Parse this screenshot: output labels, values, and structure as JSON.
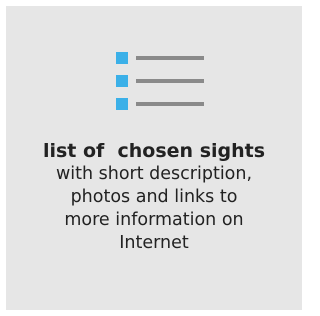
{
  "card": {
    "background": "#e6e6e6",
    "title": "list of  chosen sights",
    "description_lines": [
      "with short description,",
      "photos and links to",
      "more information on",
      "Internet"
    ]
  },
  "icon": {
    "name": "list-icon",
    "bullet_color": "#3bb0e8",
    "line_color": "#8a8a8a",
    "rows": 3
  }
}
